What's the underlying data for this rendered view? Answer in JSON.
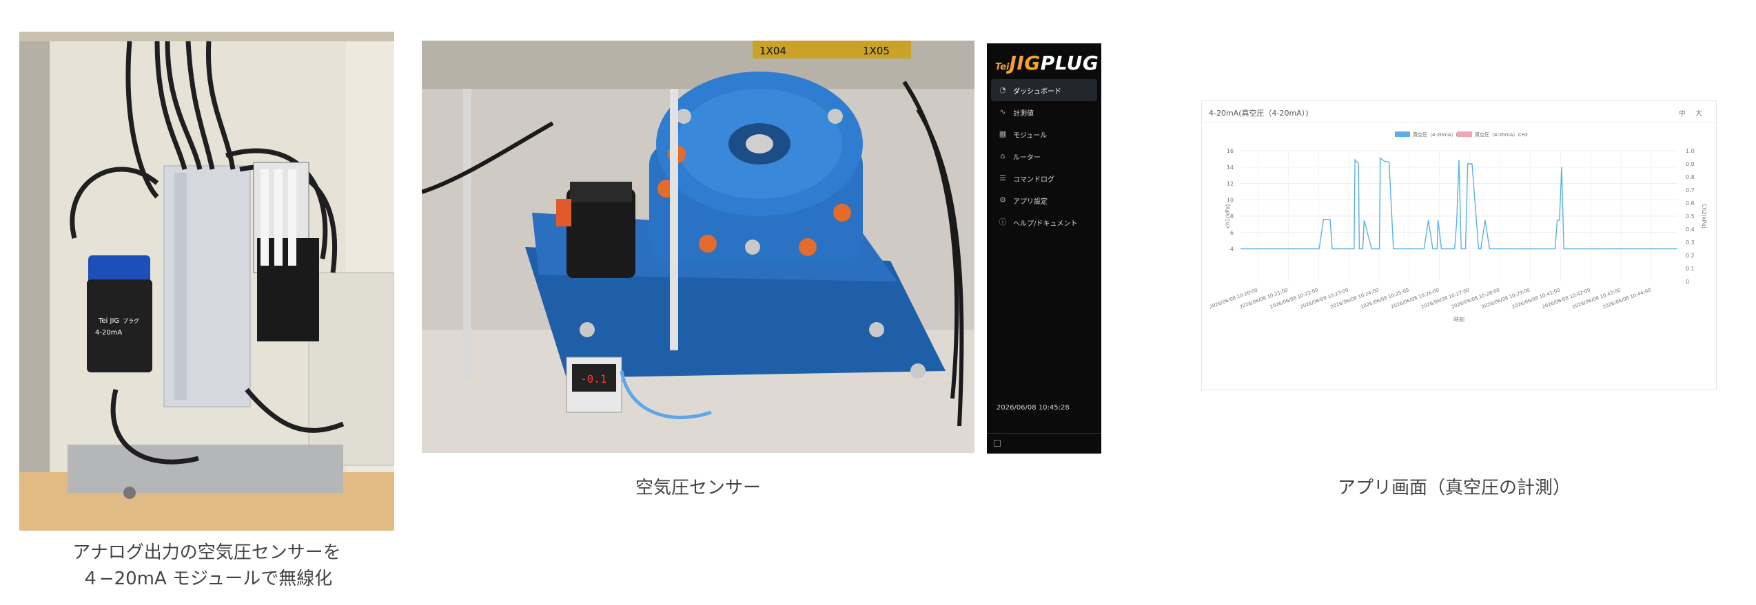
{
  "captions": {
    "left_line1": "アナログ出力の空気圧センサーを",
    "left_line2": "４−20mA モジュールで無線化",
    "middle": "空気圧センサー",
    "right": "アプリ画面（真空圧の計測）"
  },
  "photos": {
    "cabinet_labels": {
      "brand": "Tei JIG",
      "module": "4-20mA",
      "sub": "プラグ"
    },
    "jig_labels": {
      "tag1": "1X04",
      "tag2": "1X05",
      "meter": "-0.1"
    }
  },
  "app": {
    "brand_prefix": "Tei",
    "brand_jig": "JIG",
    "brand_plug": "PLUG",
    "nav": [
      {
        "icon": "dashboard-icon",
        "glyph": "◔",
        "label": "ダッシュボード",
        "active": true
      },
      {
        "icon": "measure-icon",
        "glyph": "∿",
        "label": "計測値",
        "active": false
      },
      {
        "icon": "module-icon",
        "glyph": "▦",
        "label": "モジュール",
        "active": false
      },
      {
        "icon": "router-icon",
        "glyph": "⌂",
        "label": "ルーター",
        "active": false
      },
      {
        "icon": "command-log-icon",
        "glyph": "☰",
        "label": "コマンドログ",
        "active": false
      },
      {
        "icon": "settings-icon",
        "glyph": "⚙",
        "label": "アプリ設定",
        "active": false
      },
      {
        "icon": "help-icon",
        "glyph": "ⓘ",
        "label": "ヘルプ/ドキュメント",
        "active": false
      }
    ],
    "timestamp": "2026/06/08 10:45:28",
    "colors": {
      "sidebar_bg": "#0b0b0b",
      "active_bg": "#23262d",
      "accent": "#f2a230"
    }
  },
  "card": {
    "title": "4-20mA(真空圧（4-20mA）)",
    "btn_mid": "中",
    "btn_large": "大"
  },
  "chart_data": {
    "type": "line",
    "title": "",
    "xlabel": "時刻",
    "ylabel_left": "ch1(kPa)",
    "ylabel_right": "Ch2(kPa)",
    "legend_position": "top-center",
    "grid": true,
    "ylim_left": [
      0,
      16
    ],
    "ylim_right": [
      0,
      1.0
    ],
    "y_ticks_left": [
      "16",
      "14",
      "12",
      "10",
      "8",
      "6",
      "4"
    ],
    "y_ticks_right": [
      "1.0",
      "0.9",
      "0.8",
      "0.7",
      "0.6",
      "0.5",
      "0.4",
      "0.3",
      "0.2",
      "0.1",
      "0"
    ],
    "x_ticks": [
      "2026/06/08 10:20:00",
      "2026/06/08 10:21:00",
      "2026/06/08 10:22:00",
      "2026/06/08 10:23:00",
      "2026/06/08 10:24:00",
      "2026/06/08 10:25:00",
      "2026/06/08 10:26:00",
      "2026/06/08 10:27:00",
      "2026/06/08 10:28:00",
      "2026/06/08 10:29:00",
      "2026/06/08 10:41:00",
      "2026/06/08 10:42:00",
      "2026/06/08 10:43:00",
      "2026/06/08 10:44:00"
    ],
    "series": [
      {
        "name": "真空圧（4-20mA）CH1",
        "color": "#5ab0e8",
        "axis": "left",
        "x": [
          0,
          0.12,
          0.18,
          0.19,
          0.205,
          0.21,
          0.215,
          0.22,
          0.26,
          0.262,
          0.27,
          0.272,
          0.28,
          0.283,
          0.3,
          0.31,
          0.318,
          0.32,
          0.33,
          0.34,
          0.35,
          0.352,
          0.36,
          0.38,
          0.42,
          0.43,
          0.44,
          0.45,
          0.452,
          0.46,
          0.47,
          0.49,
          0.495,
          0.5,
          0.505,
          0.51,
          0.515,
          0.52,
          0.53,
          0.545,
          0.55,
          0.56,
          0.57,
          0.58,
          0.59,
          0.6,
          0.7,
          0.72,
          0.725,
          0.73,
          0.735,
          0.74,
          0.75,
          0.78,
          1.0
        ],
        "y": [
          4,
          4,
          4,
          7.6,
          7.6,
          4,
          4,
          4,
          4,
          14.9,
          14.4,
          4,
          4,
          7.5,
          4,
          4,
          4,
          15.1,
          14.7,
          14.6,
          4,
          4,
          4,
          4,
          4,
          7.5,
          4,
          4,
          7.5,
          4,
          4,
          4,
          7.5,
          14.9,
          4,
          4,
          4,
          14.4,
          14.4,
          4,
          4,
          7.5,
          4,
          4,
          4,
          4,
          4,
          4,
          7.5,
          7.5,
          14.0,
          4,
          4,
          4,
          4
        ]
      },
      {
        "name": "真空圧（4-20mA）CH2",
        "color": "#f4a3b4",
        "axis": "right",
        "x": [],
        "y": []
      }
    ]
  }
}
